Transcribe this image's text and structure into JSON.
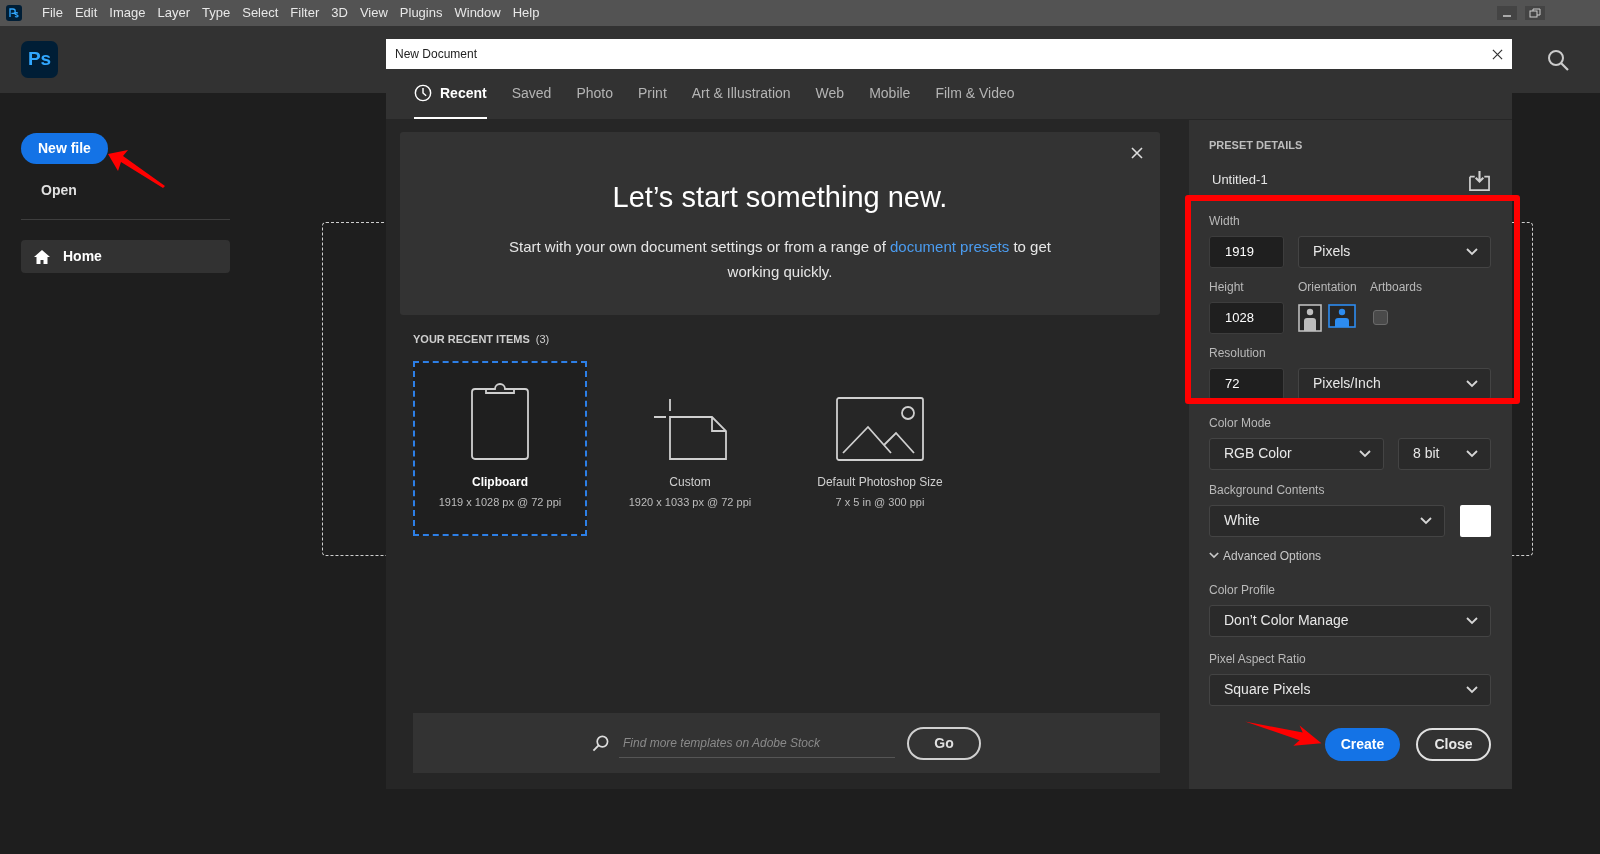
{
  "menu_bar": {
    "items": [
      "File",
      "Edit",
      "Image",
      "Layer",
      "Type",
      "Select",
      "Filter",
      "3D",
      "View",
      "Plugins",
      "Window",
      "Help"
    ]
  },
  "home": {
    "logo": "Ps",
    "new_file_button": "New file",
    "open_link": "Open",
    "nav_items": [
      {
        "label": "Home",
        "selected": true
      }
    ]
  },
  "dialog": {
    "title": "New Document",
    "tabs": [
      {
        "label": "Recent",
        "selected": true
      },
      {
        "label": "Saved",
        "selected": false
      },
      {
        "label": "Photo",
        "selected": false
      },
      {
        "label": "Print",
        "selected": false
      },
      {
        "label": "Art & Illustration",
        "selected": false
      },
      {
        "label": "Web",
        "selected": false
      },
      {
        "label": "Mobile",
        "selected": false
      },
      {
        "label": "Film & Video",
        "selected": false
      }
    ],
    "hero": {
      "title": "Let’s start something new.",
      "text_before": "Start with your own document settings or from a range of",
      "link": "document presets",
      "text_after": "to get working quickly."
    },
    "recent": {
      "heading": "YOUR RECENT ITEMS",
      "count": "(3)",
      "items": [
        {
          "kind": "clipboard",
          "name": "Clipboard",
          "detail": "1919 x 1028 px @ 72 ppi",
          "selected": true
        },
        {
          "kind": "custom",
          "name": "Custom",
          "detail": "1920 x 1033 px @ 72 ppi",
          "selected": false
        },
        {
          "kind": "photo",
          "name": "Default Photoshop Size",
          "detail": "7 x 5 in @ 300 ppi",
          "selected": false
        }
      ]
    },
    "search": {
      "placeholder": "Find more templates on Adobe Stock",
      "button": "Go"
    },
    "preset": {
      "heading": "PRESET DETAILS",
      "name": "Untitled-1",
      "width": {
        "label": "Width",
        "value": "1919",
        "unit": "Pixels"
      },
      "height": {
        "label": "Height",
        "value": "1028"
      },
      "orientation": {
        "label": "Orientation",
        "options": [
          {
            "kind": "portrait",
            "selected": false
          },
          {
            "kind": "landscape",
            "selected": true
          }
        ]
      },
      "artboards": {
        "label": "Artboards",
        "checked": false
      },
      "resolution": {
        "label": "Resolution",
        "value": "72",
        "unit": "Pixels/Inch"
      },
      "color_mode": {
        "label": "Color Mode",
        "value": "RGB Color",
        "depth": "8 bit"
      },
      "background": {
        "label": "Background Contents",
        "value": "White"
      },
      "advanced": {
        "label": "Advanced Options",
        "expanded": true
      },
      "color_profile": {
        "label": "Color Profile",
        "value": "Don’t Color Manage"
      },
      "pixel_aspect_ratio": {
        "label": "Pixel Aspect Ratio",
        "value": "Square Pixels"
      },
      "create_button": "Create",
      "close_button": "Close"
    }
  }
}
